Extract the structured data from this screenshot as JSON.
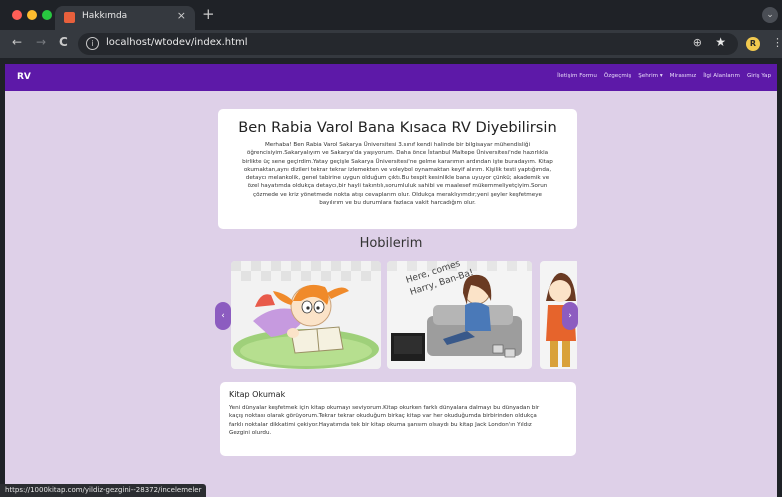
{
  "browser": {
    "tab_title": "Hakkımda",
    "url": "localhost/wtodev/index.html",
    "profile_initial": "R",
    "status_url": "https://1000kitap.com/yildiz-gezgini--28372/incelemeler",
    "icons": {
      "close": "×",
      "new_tab": "+",
      "back": "←",
      "forward": "→",
      "reload": "C",
      "info": "i",
      "zoom": "⊕",
      "star": "★",
      "menu": "⋮",
      "tab_menu": "⌄"
    },
    "colors": {
      "traffic_red": "#ff5f57",
      "traffic_yellow": "#febc2e",
      "traffic_green": "#28c840"
    }
  },
  "site": {
    "brand": "RV",
    "nav": [
      "İletişim Formu",
      "Özgeçmiş",
      "Şehrim ▾",
      "Mirasımız",
      "İlgi Alanlarım",
      "Giriş Yap"
    ],
    "accent": "#5d19a8",
    "page_bg": "#ded0e8"
  },
  "about": {
    "title": "Ben Rabia Varol Bana Kısaca RV Diyebilirsin",
    "lines": [
      "Merhaba! Ben Rabia Varol Sakarya Üniversitesi 3.sınıf kendi halinde bir bilgisayar mühendisliği",
      "öğrencisiyim.Sakaryalıyım ve Sakarya'da yaşıyorum. Daha önce İstanbul Maltepe Üniversitesi'nde hazırlıkla",
      "birlikte üç sene geçirdim.Yatay geçişle Sakarya Üniversitesi'ne gelme kararımın ardından işte buradayım. Kitap",
      "okumaktan,aynı dizileri tekrar tekrar izlemekten ve voleybol oynamaktan keyif alırım. Kişilik testi yaptığımda,",
      "detaycı melankolik, genel tabirine uygun olduğum çıktı.Bu tespit kesinlikle bana uyuyor çünkü; akademik ve",
      "özel hayatımda oldukça detaycı,bir hayli takıntılı,sorumluluk sahibi ve maalesef mükemmeliyetçiyim.Sorun",
      "çözmede ve kriz yönetmede nokta atışı cevaplarım olur. Oldukça meraklıyımdır;yeni şeyler keşfetmeye",
      "bayılırım ve bu durumlara fazlaca vakit harcadığım olur."
    ]
  },
  "hobbies": {
    "heading": "Hobilerim",
    "prev": "‹",
    "next": "›",
    "slides": [
      {
        "name": "reading-girl-illustration"
      },
      {
        "name": "watching-tv-illustration",
        "caption_1": "Here, comes",
        "caption_2": "Harry, Ban-Ba!"
      },
      {
        "name": "volleyball-illustration"
      }
    ],
    "card": {
      "title": "Kitap Okumak",
      "lines": [
        "Yeni dünyalar keşfetmek için kitap okumayı seviyorum.Kitap okurken farklı dünyalara dalmayı bu dünyadan bir",
        "kaçış noktası olarak görüyorum.Tekrar tekrar okuduğum birkaç kitap var her okuduğumda birbirinden oldukça",
        "farklı noktalar dikkatimi çekiyor.Hayatımda tek bir kitap okuma şansım olsaydı bu kitap Jack London'ın Yıldız",
        "Gezgini olurdu."
      ]
    }
  }
}
